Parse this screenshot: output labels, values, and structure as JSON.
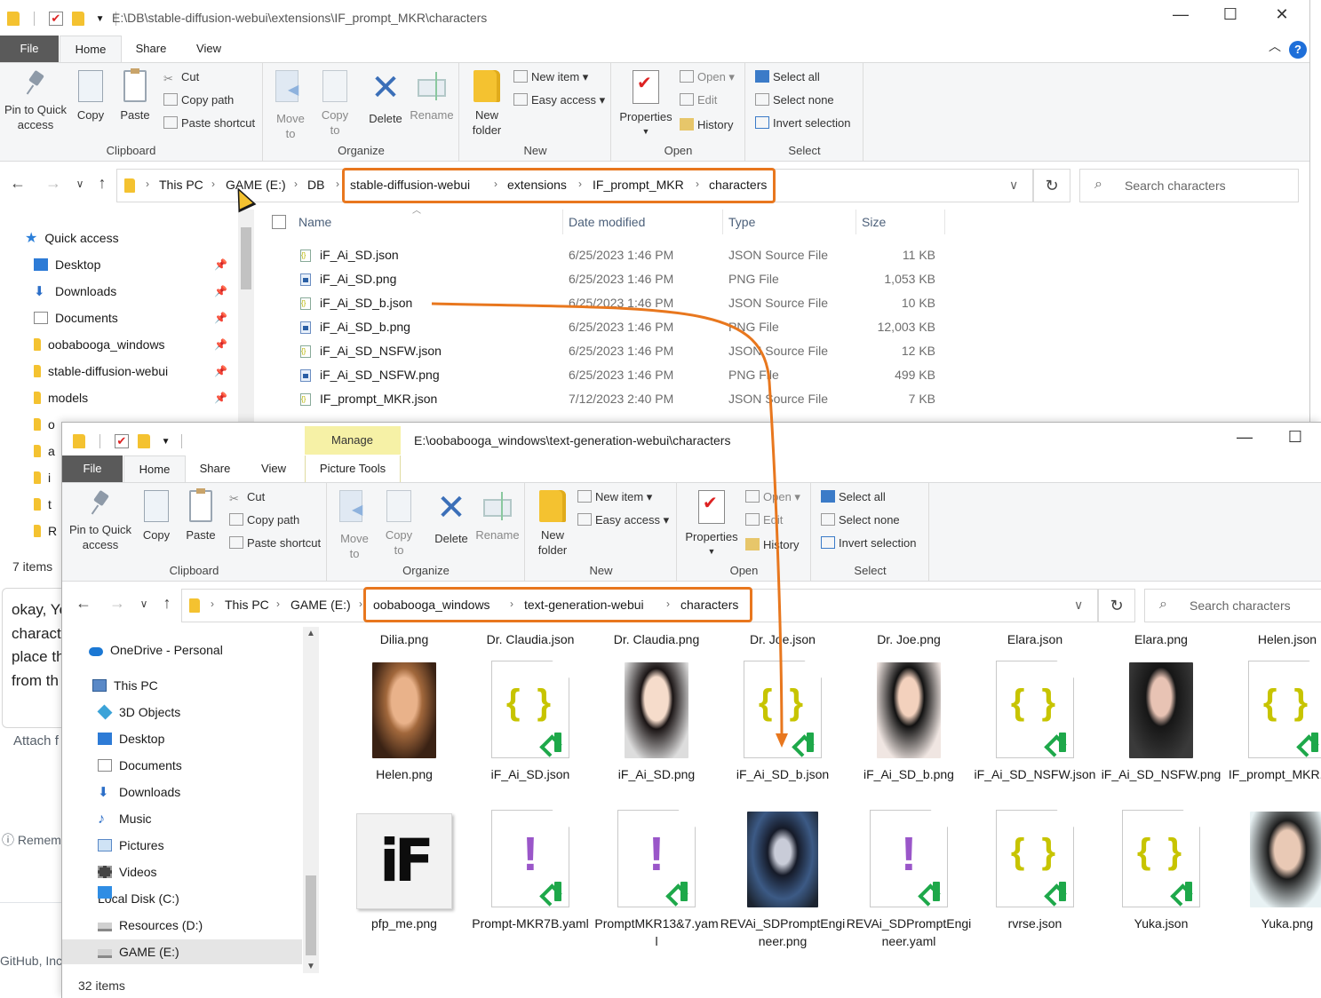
{
  "window1": {
    "title": "E:\\DB\\stable-diffusion-webui\\extensions\\IF_prompt_MKR\\characters",
    "tabs": [
      "File",
      "Home",
      "Share",
      "View"
    ],
    "ribbon": {
      "pin": "Pin to Quick access",
      "copy": "Copy",
      "paste": "Paste",
      "cut": "Cut",
      "copy_path": "Copy path",
      "paste_shortcut": "Paste shortcut",
      "clipboard": "Clipboard",
      "move_to": "Move to",
      "copy_to": "Copy to",
      "delete": "Delete",
      "rename": "Rename",
      "organize": "Organize",
      "new_folder": "New folder",
      "new_item": "New item",
      "easy_access": "Easy access",
      "new": "New",
      "properties": "Properties",
      "open": "Open",
      "edit": "Edit",
      "history": "History",
      "open_group": "Open",
      "select_all": "Select all",
      "select_none": "Select none",
      "invert_selection": "Invert selection",
      "select": "Select"
    },
    "breadcrumb": [
      "This PC",
      "GAME (E:)",
      "DB",
      "stable-diffusion-webui",
      "extensions",
      "IF_prompt_MKR",
      "characters"
    ],
    "search_placeholder": "Search characters",
    "nav": [
      {
        "label": "Quick access",
        "icon": "star-icon"
      },
      {
        "label": "Desktop",
        "icon": "desktop-icon",
        "pinned": true
      },
      {
        "label": "Downloads",
        "icon": "downloads-icon",
        "pinned": true
      },
      {
        "label": "Documents",
        "icon": "documents-icon",
        "pinned": true
      },
      {
        "label": "oobabooga_windows",
        "icon": "folder-icon",
        "pinned": true
      },
      {
        "label": "stable-diffusion-webui",
        "icon": "folder-icon",
        "pinned": true
      },
      {
        "label": "models",
        "icon": "folder-icon",
        "pinned": true
      },
      {
        "label": "o",
        "icon": "folder-icon"
      },
      {
        "label": "a",
        "icon": "folder-icon"
      },
      {
        "label": "i",
        "icon": "folder-icon"
      },
      {
        "label": "t",
        "icon": "folder-icon"
      },
      {
        "label": "R",
        "icon": "folder-icon"
      }
    ],
    "columns": {
      "name": "Name",
      "date": "Date modified",
      "type": "Type",
      "size": "Size"
    },
    "files": [
      {
        "name": "iF_Ai_SD.json",
        "date": "6/25/2023 1:46 PM",
        "type": "JSON Source File",
        "size": "11 KB",
        "kind": "json"
      },
      {
        "name": "iF_Ai_SD.png",
        "date": "6/25/2023 1:46 PM",
        "type": "PNG File",
        "size": "1,053 KB",
        "kind": "png"
      },
      {
        "name": "iF_Ai_SD_b.json",
        "date": "6/25/2023 1:46 PM",
        "type": "JSON Source File",
        "size": "10 KB",
        "kind": "json"
      },
      {
        "name": "iF_Ai_SD_b.png",
        "date": "6/25/2023 1:46 PM",
        "type": "PNG File",
        "size": "12,003 KB",
        "kind": "png"
      },
      {
        "name": "iF_Ai_SD_NSFW.json",
        "date": "6/25/2023 1:46 PM",
        "type": "JSON Source File",
        "size": "12 KB",
        "kind": "json"
      },
      {
        "name": "iF_Ai_SD_NSFW.png",
        "date": "6/25/2023 1:46 PM",
        "type": "PNG File",
        "size": "499 KB",
        "kind": "png"
      },
      {
        "name": "IF_prompt_MKR.json",
        "date": "7/12/2023 2:40 PM",
        "type": "JSON Source File",
        "size": "7 KB",
        "kind": "json"
      }
    ],
    "status": "7 items"
  },
  "window2": {
    "title": "E:\\oobabooga_windows\\text-generation-webui\\characters",
    "context_tab": "Manage",
    "context_sub": "Picture Tools",
    "tabs": [
      "File",
      "Home",
      "Share",
      "View"
    ],
    "breadcrumb": [
      "This PC",
      "GAME (E:)",
      "oobabooga_windows",
      "text-generation-webui",
      "characters"
    ],
    "search_placeholder": "Search characters",
    "nav": [
      {
        "label": "OneDrive - Personal",
        "icon": "onedrive-icon"
      },
      {
        "label": "This PC",
        "icon": "this-pc-icon"
      },
      {
        "label": "3D Objects",
        "icon": "3d-objects-icon"
      },
      {
        "label": "Desktop",
        "icon": "desktop-icon"
      },
      {
        "label": "Documents",
        "icon": "documents-icon"
      },
      {
        "label": "Downloads",
        "icon": "downloads-icon"
      },
      {
        "label": "Music",
        "icon": "music-icon"
      },
      {
        "label": "Pictures",
        "icon": "pictures-icon"
      },
      {
        "label": "Videos",
        "icon": "videos-icon"
      },
      {
        "label": "Local Disk (C:)",
        "icon": "windows-drive-icon"
      },
      {
        "label": "Resources (D:)",
        "icon": "drive-icon"
      },
      {
        "label": "GAME (E:)",
        "icon": "drive-icon",
        "selected": true
      }
    ],
    "tiles_row0": [
      "Dilia.png",
      "Dr. Claudia.json",
      "Dr. Claudia.png",
      "Dr. Joe.json",
      "Dr. Joe.png",
      "Elara.json",
      "Elara.png",
      "Helen.json"
    ],
    "tiles_row1": [
      "Helen.png",
      "iF_Ai_SD.json",
      "iF_Ai_SD.png",
      "iF_Ai_SD_b.json",
      "iF_Ai_SD_b.png",
      "iF_Ai_SD_NSFW.json",
      "iF_Ai_SD_NSFW.png",
      "IF_prompt_MKR.json"
    ],
    "tiles_row2": [
      "pfp_me.png",
      "Prompt-MKR7B.yaml",
      "PromptMKR13&7.yaml",
      "REVAi_SDPromptEngineer.png",
      "REVAi_SDPromptEngineer.yaml",
      "rvrse.json",
      "Yuka.json",
      "Yuka.png"
    ],
    "pfp_text": "iF",
    "status": "32 items"
  },
  "background": {
    "chat_lines": [
      "okay, Ye",
      "charact",
      "place th",
      "from th"
    ],
    "attach": "Attach f",
    "reminder": "Remem",
    "footer": "GitHub, Inc"
  },
  "colors": {
    "accent_orange": "#e8771e",
    "folder_yellow": "#f4c230",
    "ribbon_bg": "#f5f6f7"
  }
}
